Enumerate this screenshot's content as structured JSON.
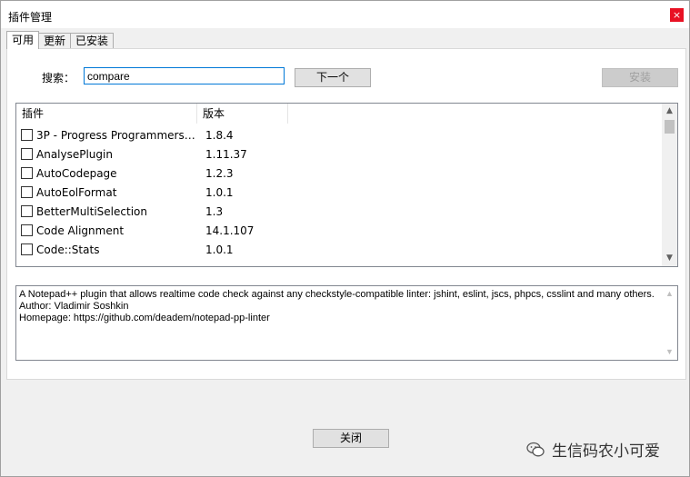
{
  "window": {
    "title": "插件管理",
    "close_glyph": "×"
  },
  "tabs": [
    {
      "label": "可用",
      "active": true
    },
    {
      "label": "更新",
      "active": false
    },
    {
      "label": "已安装",
      "active": false
    }
  ],
  "search": {
    "label": "搜索：",
    "value": "compare"
  },
  "buttons": {
    "next": "下一个",
    "install": "安装",
    "close": "关闭"
  },
  "table": {
    "columns": [
      "插件",
      "版本"
    ],
    "rows": [
      {
        "name": "3P - Progress Programmers ...",
        "version": "1.8.4"
      },
      {
        "name": "AnalysePlugin",
        "version": "1.11.37"
      },
      {
        "name": "AutoCodepage",
        "version": "1.2.3"
      },
      {
        "name": "AutoEolFormat",
        "version": "1.0.1"
      },
      {
        "name": "BetterMultiSelection",
        "version": "1.3"
      },
      {
        "name": "Code Alignment",
        "version": "14.1.107"
      },
      {
        "name": "Code::Stats",
        "version": "1.0.1"
      }
    ]
  },
  "description": {
    "lines": [
      "A Notepad++ plugin that allows realtime code check against any checkstyle-compatible linter: jshint, eslint, jscs, phpcs, csslint and many others.",
      "Author: Vladimir Soshkin",
      "Homepage: https://github.com/deadem/notepad-pp-linter"
    ]
  },
  "watermark": {
    "text": "生信码农小可爱",
    "icon": "wechat-icon"
  },
  "colors": {
    "close_red": "#e81123",
    "input_focus": "#0078d7"
  }
}
